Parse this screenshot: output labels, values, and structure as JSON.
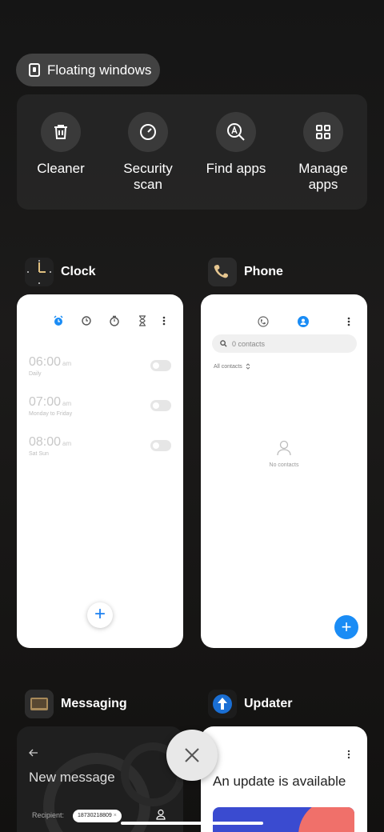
{
  "floating": {
    "label": "Floating windows"
  },
  "tools": [
    {
      "label": "Cleaner",
      "icon": "trash-icon"
    },
    {
      "label": "Security scan",
      "icon": "gauge-icon"
    },
    {
      "label": "Find apps",
      "icon": "search-apps-icon"
    },
    {
      "label": "Manage apps",
      "icon": "grid-icon"
    }
  ],
  "apps": {
    "clock": {
      "name": "Clock",
      "alarms": [
        {
          "time": "06:00",
          "ampm": "am",
          "repeat": "Daily"
        },
        {
          "time": "07:00",
          "ampm": "am",
          "repeat": "Monday to Friday"
        },
        {
          "time": "08:00",
          "ampm": "am",
          "repeat": "Sat Sun"
        }
      ],
      "fab": "+"
    },
    "phone": {
      "name": "Phone",
      "search_placeholder": "0 contacts",
      "filter": "All contacts",
      "empty": "No contacts",
      "fab": "+"
    },
    "messaging": {
      "name": "Messaging",
      "title": "New message",
      "recipient_label": "Recipient:",
      "recipient_value": "18730218809"
    },
    "updater": {
      "name": "Updater",
      "title": "An update is available"
    }
  },
  "colors": {
    "accent": "#1a8cf5",
    "card": "#ffffff",
    "background": "#161514"
  }
}
